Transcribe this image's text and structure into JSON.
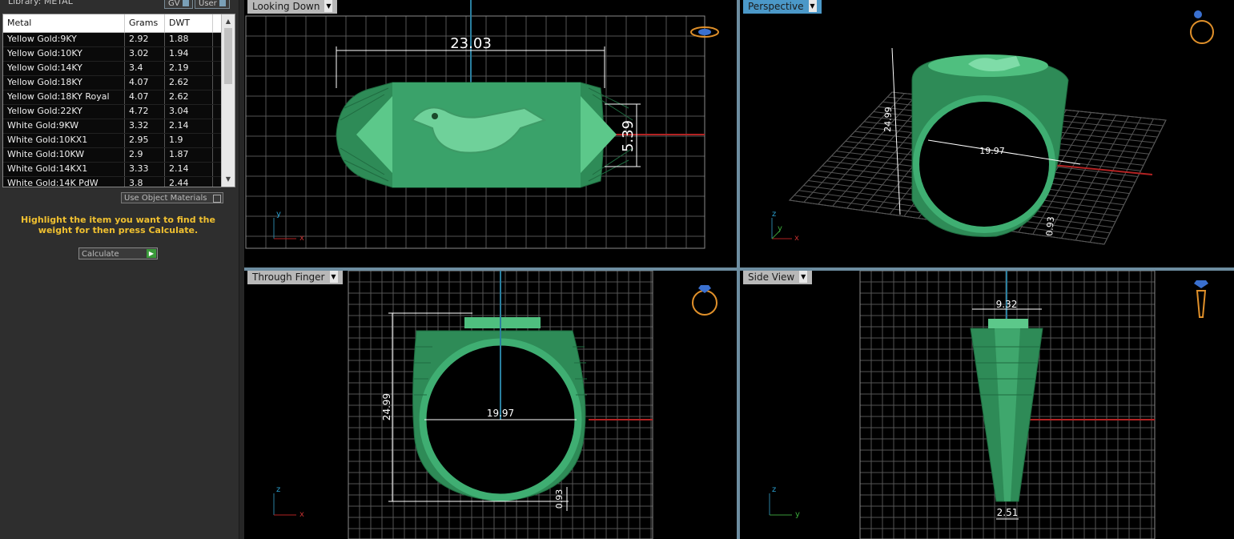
{
  "library": {
    "label": "Library: METAL",
    "gv_label": "GV",
    "user_label": "User"
  },
  "table": {
    "headers": {
      "metal": "Metal",
      "grams": "Grams",
      "dwt": "DWT"
    },
    "rows": [
      {
        "metal": "Yellow Gold:9KY",
        "grams": "2.92",
        "dwt": "1.88"
      },
      {
        "metal": "Yellow Gold:10KY",
        "grams": "3.02",
        "dwt": "1.94"
      },
      {
        "metal": "Yellow Gold:14KY",
        "grams": "3.4",
        "dwt": "2.19"
      },
      {
        "metal": "Yellow Gold:18KY",
        "grams": "4.07",
        "dwt": "2.62"
      },
      {
        "metal": "Yellow Gold:18KY Royal",
        "grams": "4.07",
        "dwt": "2.62"
      },
      {
        "metal": "Yellow Gold:22KY",
        "grams": "4.72",
        "dwt": "3.04"
      },
      {
        "metal": "White Gold:9KW",
        "grams": "3.32",
        "dwt": "2.14"
      },
      {
        "metal": "White Gold:10KX1",
        "grams": "2.95",
        "dwt": "1.9"
      },
      {
        "metal": "White Gold:10KW",
        "grams": "2.9",
        "dwt": "1.87"
      },
      {
        "metal": "White Gold:14KX1",
        "grams": "3.33",
        "dwt": "2.14"
      },
      {
        "metal": "White Gold:14K PdW",
        "grams": "3.8",
        "dwt": "2.44"
      }
    ]
  },
  "controls": {
    "use_object_materials": "Use Object Materials",
    "hint": "Highlight the item you want to find the weight for then press Calculate.",
    "calculate": "Calculate"
  },
  "viewports": {
    "top": {
      "label": "Looking Down",
      "dim_width": "23.03",
      "dim_height": "5.39",
      "axis_v": "y",
      "axis_h": "x"
    },
    "perspective": {
      "label": "Perspective",
      "dim_height": "24.99",
      "dim_inner": "19.97",
      "dim_shank": "0.93",
      "axis_v": "z",
      "axis_h": "x",
      "axis_d": "y"
    },
    "front": {
      "label": "Through Finger",
      "dim_height": "24.99",
      "dim_inner": "19.97",
      "dim_shank": "0.93",
      "axis_v": "z",
      "axis_h": "x"
    },
    "side": {
      "label": "Side View",
      "dim_top": "9.32",
      "dim_bottom": "2.51",
      "axis_v": "z",
      "axis_h": "y"
    }
  },
  "colors": {
    "ring": "#2e8b57",
    "ring_light": "#4fbf7f",
    "grid": "#6a6a6a",
    "dim": "#ffffff",
    "axis_red": "#b22222",
    "axis_blue": "#2a7f9f",
    "hint": "#f0c030"
  }
}
